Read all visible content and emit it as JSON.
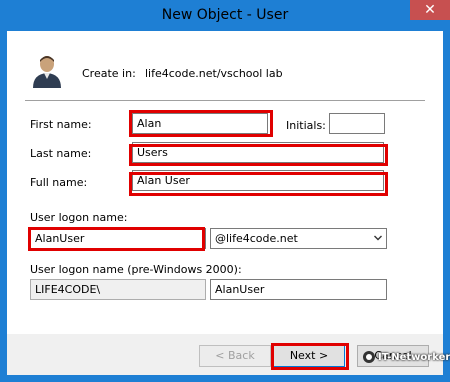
{
  "window": {
    "title": "New Object - User",
    "close_glyph": "✕"
  },
  "header": {
    "create_in_label": "Create in:",
    "create_in_value": "life4code.net/vschool lab",
    "icon": "user-icon"
  },
  "form": {
    "first_name_label": "First name:",
    "first_name_value": "Alan",
    "initials_label": "Initials:",
    "initials_value": "",
    "last_name_label": "Last name:",
    "last_name_value": "Users",
    "full_name_label": "Full name:",
    "full_name_value": "Alan User",
    "logon_name_label": "User logon name:",
    "logon_name_value": "AlanUser",
    "domain_value": "@life4code.net",
    "pre2000_label": "User logon name (pre-Windows 2000):",
    "pre2000_domain_value": "LIFE4CODE\\",
    "pre2000_name_value": "AlanUser"
  },
  "buttons": {
    "back_label": "< Back",
    "next_label": "Next >",
    "cancel_label": "Cancel"
  },
  "watermark": {
    "text": "IT-Networkers"
  },
  "colors": {
    "titlebar": "#1e7fd4",
    "highlight": "#e00000",
    "close": "#c75050"
  }
}
